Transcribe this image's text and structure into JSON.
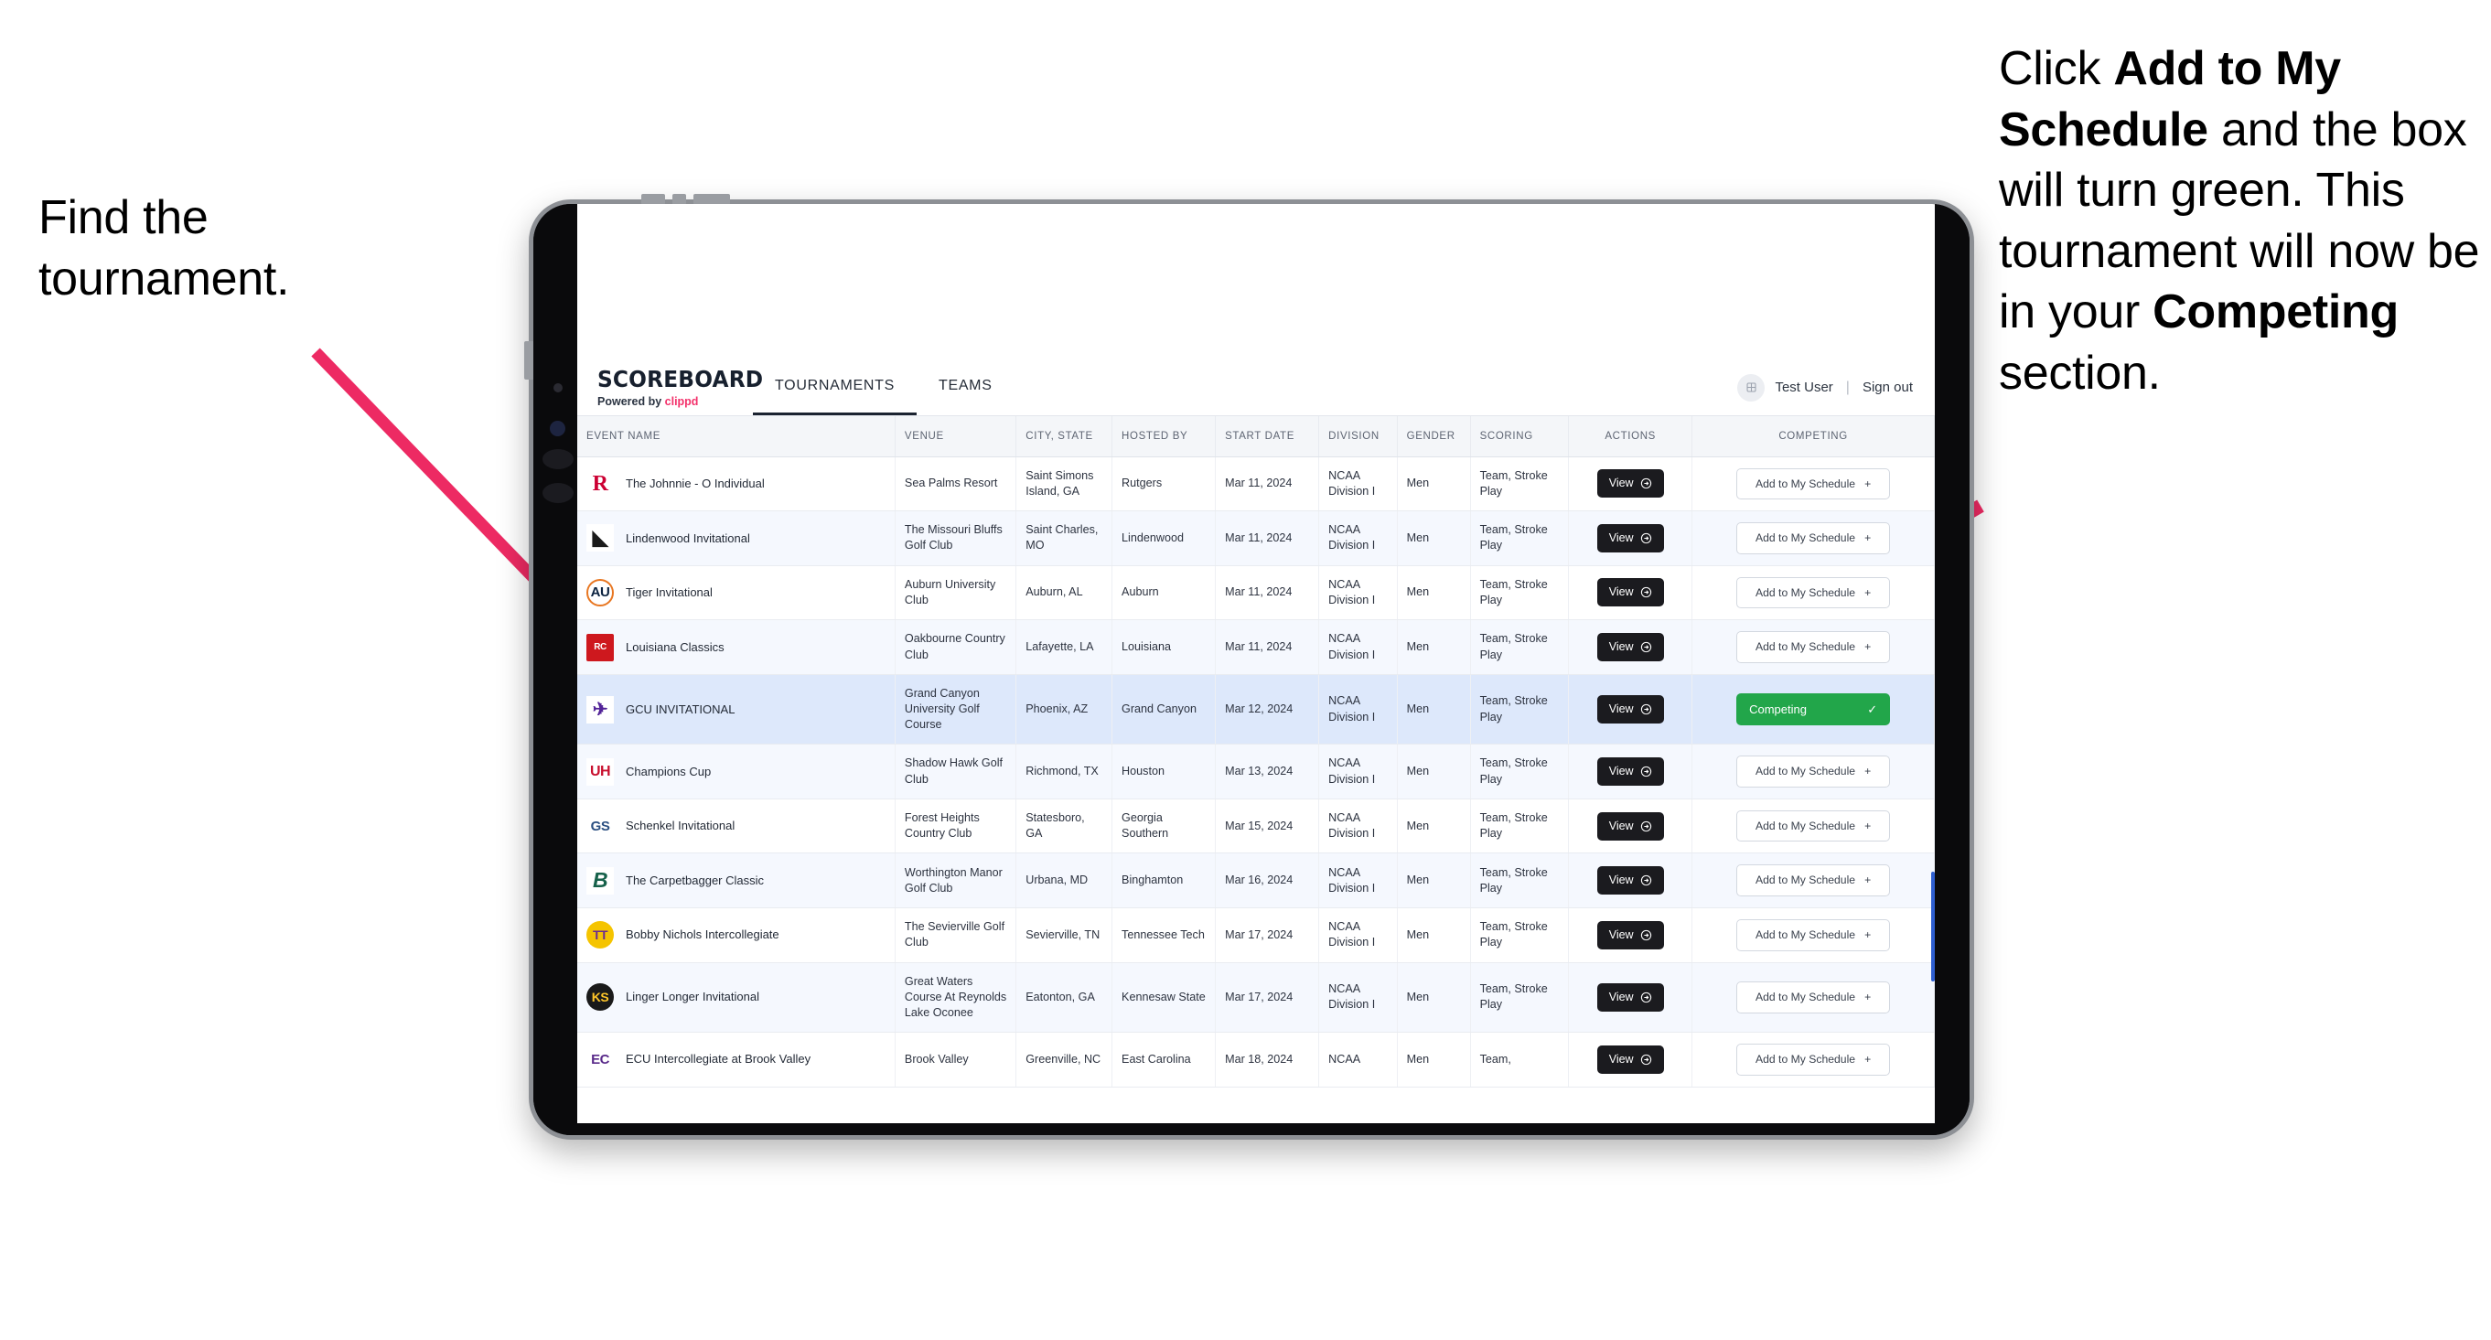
{
  "annotations": {
    "left": "Find the tournament.",
    "right_parts": [
      {
        "text": "Click ",
        "bold": false
      },
      {
        "text": "Add to My Schedule",
        "bold": true
      },
      {
        "text": " and the box will turn green. This tournament will now be in your ",
        "bold": false
      },
      {
        "text": "Competing",
        "bold": true
      },
      {
        "text": " section.",
        "bold": false
      }
    ],
    "arrow_color": "#ed2a63"
  },
  "app": {
    "brand": {
      "title": "SCOREBOARD",
      "powered_prefix": "Powered by ",
      "powered_brand": "clippd"
    },
    "tabs": [
      {
        "label": "TOURNAMENTS",
        "active": true
      },
      {
        "label": "TEAMS",
        "active": false
      }
    ],
    "user": {
      "name": "Test User",
      "separator": "|",
      "sign_out": "Sign out",
      "avatar_icon": "user-avatar-icon"
    },
    "scrollbar_color": "#2f5fd0"
  },
  "table": {
    "columns": [
      "EVENT NAME",
      "VENUE",
      "CITY, STATE",
      "HOSTED BY",
      "START DATE",
      "DIVISION",
      "GENDER",
      "SCORING",
      "ACTIONS",
      "COMPETING"
    ],
    "action_labels": {
      "view": "View",
      "add": "Add to My Schedule",
      "add_plus": "+",
      "competing": "Competing",
      "competing_check": "✓"
    },
    "rows": [
      {
        "event": "The Johnnie - O Individual",
        "logo": "rutgers-logo",
        "venue": "Sea Palms Resort",
        "city": "Saint Simons Island, GA",
        "hosted_by": "Rutgers",
        "start_date": "Mar 11, 2024",
        "division": "NCAA Division I",
        "gender": "Men",
        "scoring": "Team, Stroke Play",
        "competing": false,
        "selected": false
      },
      {
        "event": "Lindenwood Invitational",
        "logo": "lindenwood-logo",
        "venue": "The Missouri Bluffs Golf Club",
        "city": "Saint Charles, MO",
        "hosted_by": "Lindenwood",
        "start_date": "Mar 11, 2024",
        "division": "NCAA Division I",
        "gender": "Men",
        "scoring": "Team, Stroke Play",
        "competing": false,
        "selected": false
      },
      {
        "event": "Tiger Invitational",
        "logo": "auburn-logo",
        "venue": "Auburn University Club",
        "city": "Auburn, AL",
        "hosted_by": "Auburn",
        "start_date": "Mar 11, 2024",
        "division": "NCAA Division I",
        "gender": "Men",
        "scoring": "Team, Stroke Play",
        "competing": false,
        "selected": false
      },
      {
        "event": "Louisiana Classics",
        "logo": "louisiana-logo",
        "venue": "Oakbourne Country Club",
        "city": "Lafayette, LA",
        "hosted_by": "Louisiana",
        "start_date": "Mar 11, 2024",
        "division": "NCAA Division I",
        "gender": "Men",
        "scoring": "Team, Stroke Play",
        "competing": false,
        "selected": false
      },
      {
        "event": "GCU INVITATIONAL",
        "logo": "grand-canyon-logo",
        "venue": "Grand Canyon University Golf Course",
        "city": "Phoenix, AZ",
        "hosted_by": "Grand Canyon",
        "start_date": "Mar 12, 2024",
        "division": "NCAA Division I",
        "gender": "Men",
        "scoring": "Team, Stroke Play",
        "competing": true,
        "selected": true
      },
      {
        "event": "Champions Cup",
        "logo": "houston-logo",
        "venue": "Shadow Hawk Golf Club",
        "city": "Richmond, TX",
        "hosted_by": "Houston",
        "start_date": "Mar 13, 2024",
        "division": "NCAA Division I",
        "gender": "Men",
        "scoring": "Team, Stroke Play",
        "competing": false,
        "selected": false
      },
      {
        "event": "Schenkel Invitational",
        "logo": "georgia-southern-logo",
        "venue": "Forest Heights Country Club",
        "city": "Statesboro, GA",
        "hosted_by": "Georgia Southern",
        "start_date": "Mar 15, 2024",
        "division": "NCAA Division I",
        "gender": "Men",
        "scoring": "Team, Stroke Play",
        "competing": false,
        "selected": false
      },
      {
        "event": "The Carpetbagger Classic",
        "logo": "binghamton-logo",
        "venue": "Worthington Manor Golf Club",
        "city": "Urbana, MD",
        "hosted_by": "Binghamton",
        "start_date": "Mar 16, 2024",
        "division": "NCAA Division I",
        "gender": "Men",
        "scoring": "Team, Stroke Play",
        "competing": false,
        "selected": false
      },
      {
        "event": "Bobby Nichols Intercollegiate",
        "logo": "tennessee-tech-logo",
        "venue": "The Sevierville Golf Club",
        "city": "Sevierville, TN",
        "hosted_by": "Tennessee Tech",
        "start_date": "Mar 17, 2024",
        "division": "NCAA Division I",
        "gender": "Men",
        "scoring": "Team, Stroke Play",
        "competing": false,
        "selected": false
      },
      {
        "event": "Linger Longer Invitational",
        "logo": "kennesaw-state-logo",
        "venue": "Great Waters Course At Reynolds Lake Oconee",
        "city": "Eatonton, GA",
        "hosted_by": "Kennesaw State",
        "start_date": "Mar 17, 2024",
        "division": "NCAA Division I",
        "gender": "Men",
        "scoring": "Team, Stroke Play",
        "competing": false,
        "selected": false
      },
      {
        "event": "ECU Intercollegiate at Brook Valley",
        "logo": "east-carolina-logo",
        "venue": "Brook Valley",
        "city": "Greenville, NC",
        "hosted_by": "East Carolina",
        "start_date": "Mar 18, 2024",
        "division": "NCAA",
        "gender": "Men",
        "scoring": "Team,",
        "competing": false,
        "selected": false,
        "clipped": true
      }
    ]
  }
}
